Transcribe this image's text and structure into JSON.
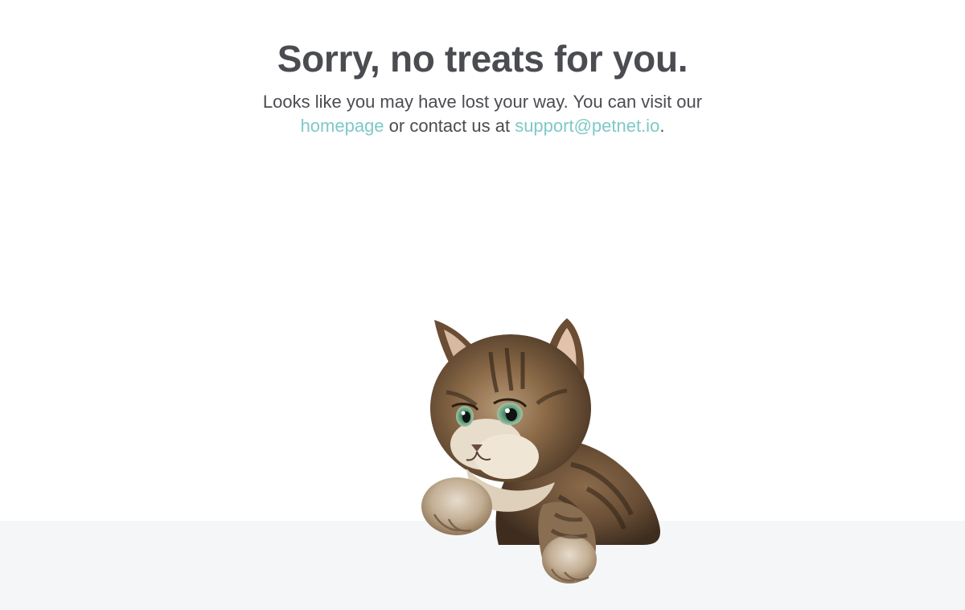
{
  "error_page": {
    "headline": "Sorry, no treats for you.",
    "message": {
      "line_start": "Looks like you may have lost your way. You can visit our ",
      "homepage_link": "homepage",
      "middle": " or contact us at ",
      "support_email_link": "support@petnet.io",
      "end": "."
    }
  },
  "illustration": {
    "icon": "kitten-icon"
  },
  "colors": {
    "text": "#4a4c51",
    "link": "#7ec9c6",
    "floor": "#f5f6f8",
    "background": "#ffffff"
  }
}
